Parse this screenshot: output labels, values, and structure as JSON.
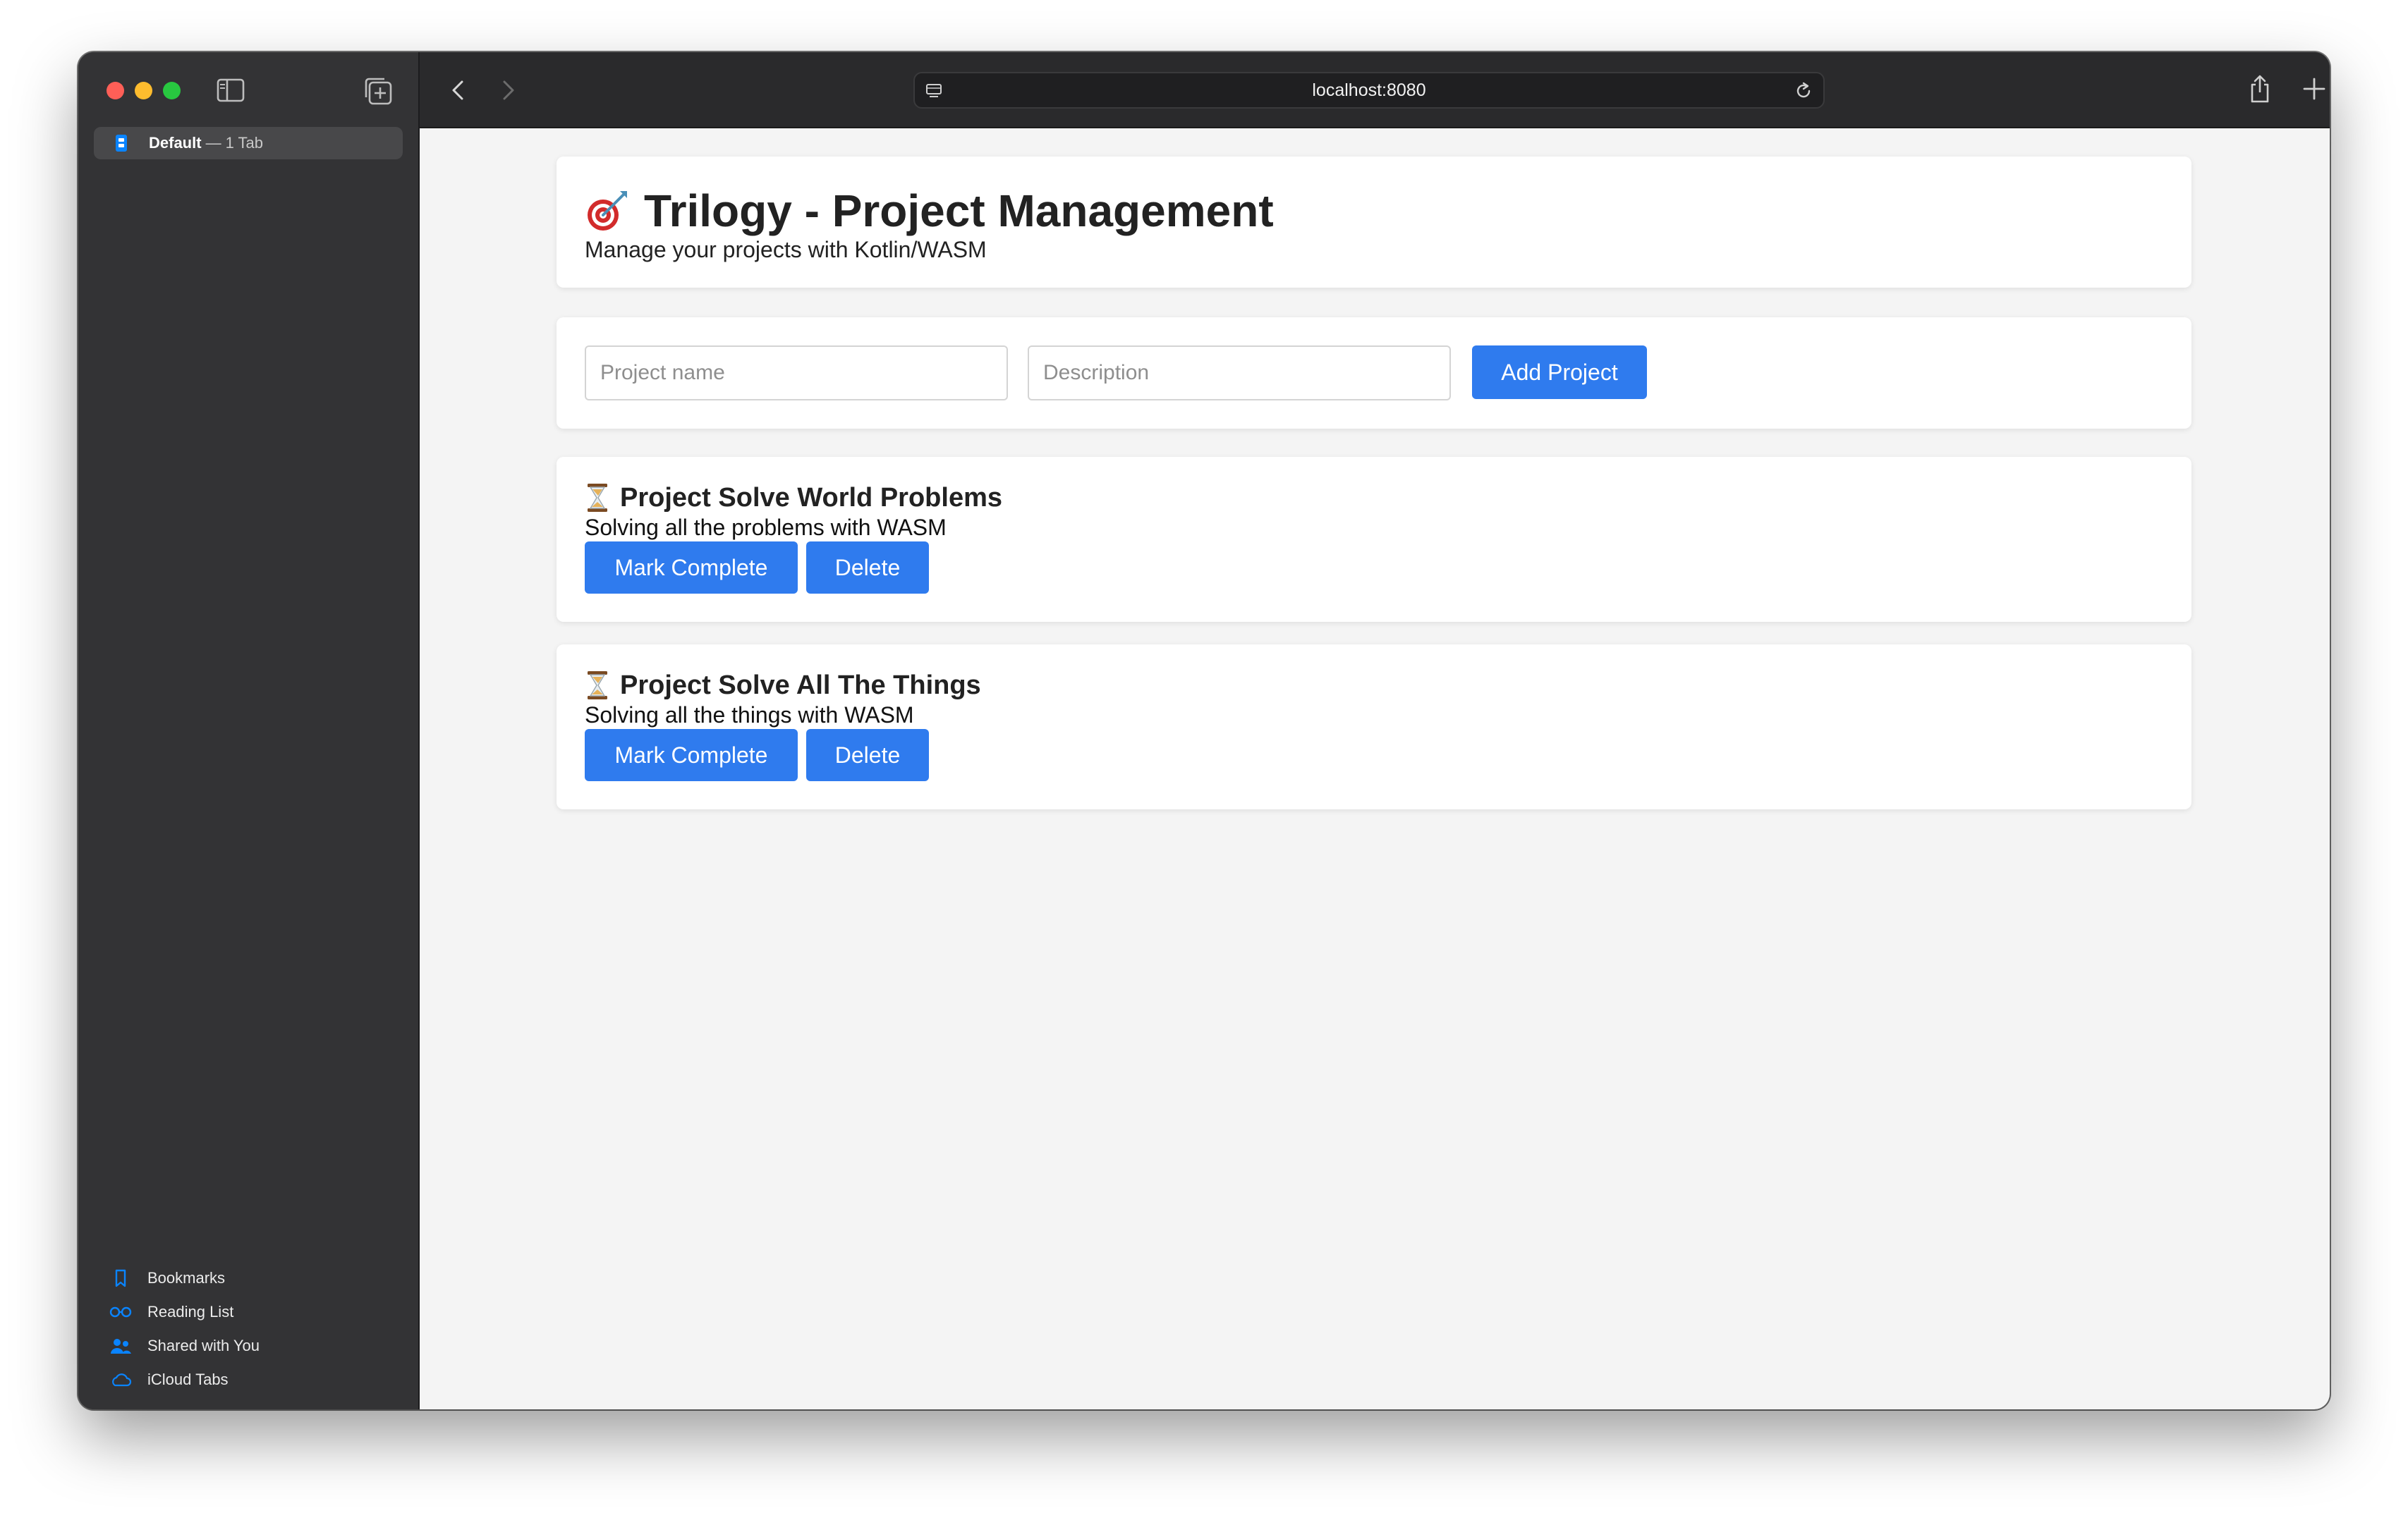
{
  "browser": {
    "sidebar": {
      "tab_group": {
        "name": "Default",
        "separator": "—",
        "count": "1 Tab"
      },
      "bottom_items": [
        {
          "label": "Bookmarks",
          "icon": "bookmark-icon"
        },
        {
          "label": "Reading List",
          "icon": "glasses-icon"
        },
        {
          "label": "Shared with You",
          "icon": "shared-people-icon"
        },
        {
          "label": "iCloud Tabs",
          "icon": "cloud-icon"
        }
      ]
    },
    "address_bar": {
      "url": "localhost:8080"
    },
    "accent_color": "#0a84ff"
  },
  "app": {
    "title": "Trilogy - Project Management",
    "title_icon": "target-icon",
    "subtitle": "Manage your projects with Kotlin/WASM",
    "form": {
      "name_placeholder": "Project name",
      "description_placeholder": "Description",
      "add_button": "Add Project"
    },
    "button_color": "#2f7bee",
    "projects": [
      {
        "status_icon": "hourglass-icon",
        "name": "Project Solve World Problems",
        "description": "Solving all the problems with WASM",
        "complete_button": "Mark Complete",
        "delete_button": "Delete"
      },
      {
        "status_icon": "hourglass-icon",
        "name": "Project Solve All The Things",
        "description": "Solving all the things with WASM",
        "complete_button": "Mark Complete",
        "delete_button": "Delete"
      }
    ]
  }
}
